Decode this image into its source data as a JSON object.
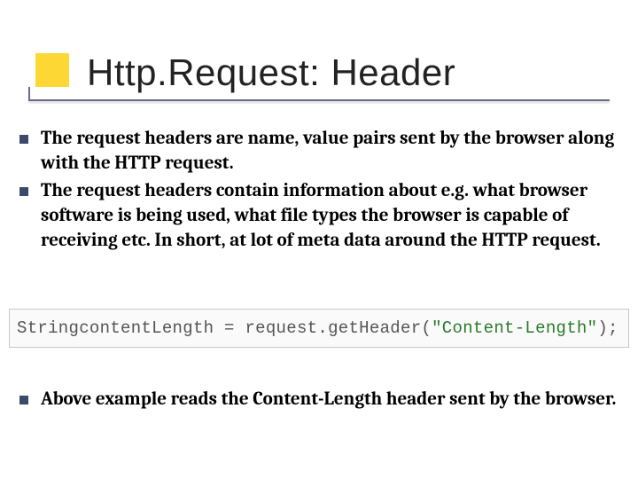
{
  "title": "Http.Request: Header",
  "bullets_top": [
    "The request headers are name, value pairs sent by the browser along with the HTTP request.",
    "The request headers contain information about e.g. what browser software is being used, what file types the browser is capable of receiving etc. In short, at lot of meta data around  the HTTP request."
  ],
  "code": {
    "type_kw": "String",
    "var_name": "contentLength",
    "assign": " = ",
    "obj": "request",
    "dot": ".",
    "method": "getHeader",
    "open": "(",
    "arg_str": "\"Content-Length\"",
    "close": ");"
  },
  "bullets_bottom": [
    "Above example reads the Content-Length header sent by the browser."
  ]
}
